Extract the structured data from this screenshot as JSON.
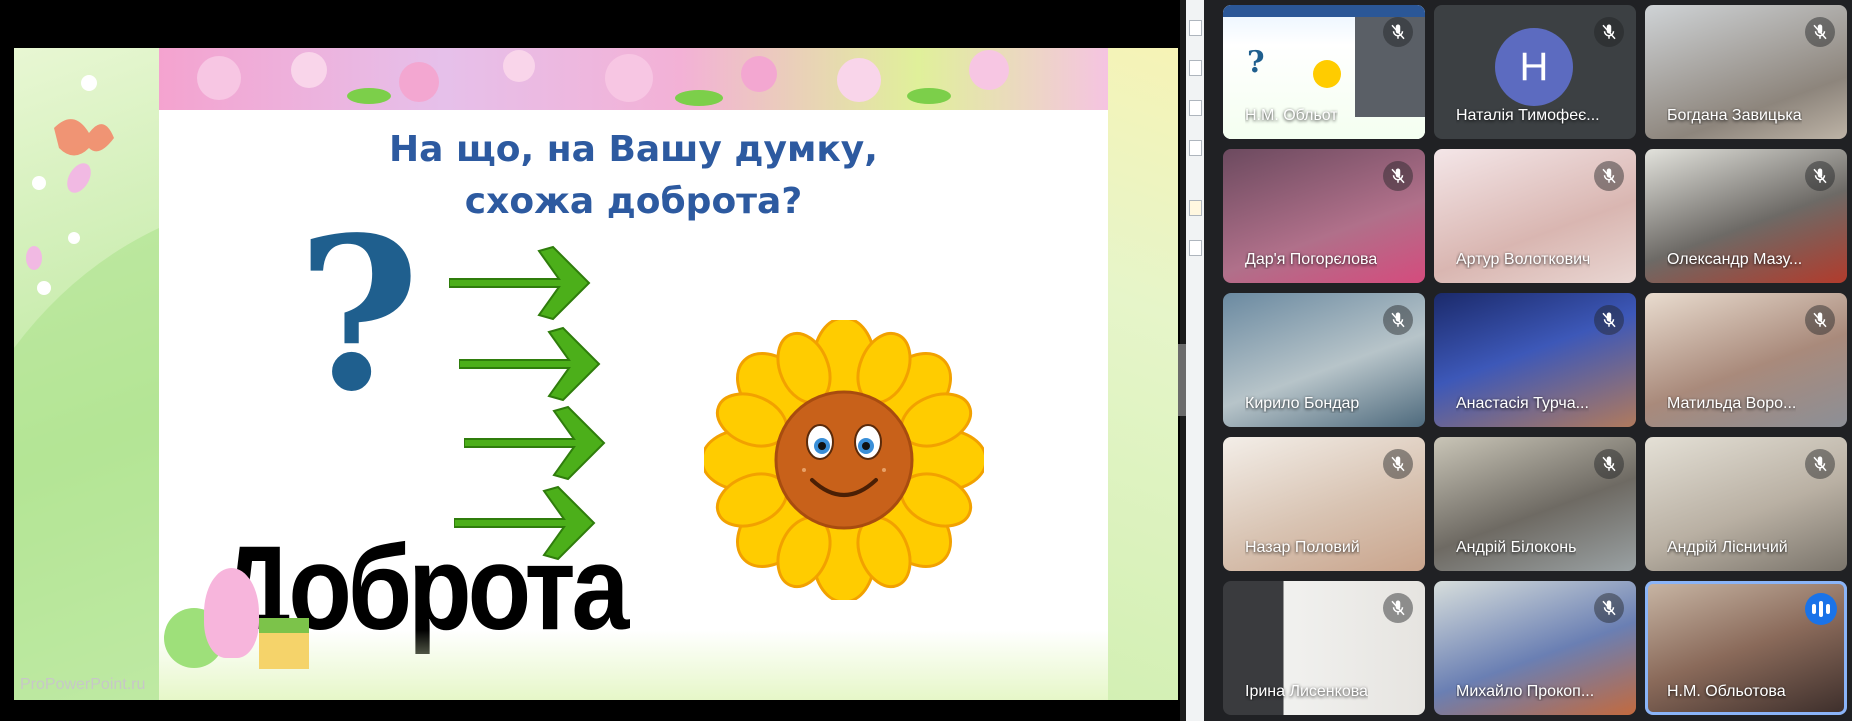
{
  "slide": {
    "title": "На що, на Вашу думку, схожа доброта?",
    "word": "Доброта",
    "question_mark": "?",
    "watermark": "ProPowerPoint.ru"
  },
  "participants": [
    {
      "name": "Н.М. Обльот",
      "mic": "muted",
      "kind": "screen-share"
    },
    {
      "name": "Наталія Тимофеє...",
      "mic": "muted",
      "kind": "avatar",
      "initial": "H",
      "avatar_color": "#5c6bc0"
    },
    {
      "name": "Богдана Завицька",
      "mic": "muted",
      "kind": "video"
    },
    {
      "name": "Дар'я Погорєлова",
      "mic": "muted",
      "kind": "video"
    },
    {
      "name": "Артур Волоткович",
      "mic": "muted",
      "kind": "video"
    },
    {
      "name": "Олександр Мазу...",
      "mic": "muted",
      "kind": "video"
    },
    {
      "name": "Кирило Бондар",
      "mic": "muted",
      "kind": "video"
    },
    {
      "name": "Анастасія Турча...",
      "mic": "muted",
      "kind": "video"
    },
    {
      "name": "Матильда Воро...",
      "mic": "muted",
      "kind": "video"
    },
    {
      "name": "Назар Половий",
      "mic": "muted",
      "kind": "video"
    },
    {
      "name": "Андрій Білоконь",
      "mic": "muted",
      "kind": "video"
    },
    {
      "name": "Андрій Лісничий",
      "mic": "muted",
      "kind": "video"
    },
    {
      "name": "Ірина Лисенкова",
      "mic": "muted",
      "kind": "video"
    },
    {
      "name": "Михайло Прокоп...",
      "mic": "muted",
      "kind": "video"
    },
    {
      "name": "Н.М. Обльотова",
      "mic": "speaking",
      "kind": "video"
    }
  ],
  "colors": {
    "grid_bg": "#202124",
    "active_border": "#8ab4f8",
    "speaking_badge": "#1a73e8",
    "title_blue": "#2d5aa0",
    "arrow_green": "#4caf1a",
    "petal_yellow": "#ffcc00"
  },
  "icons": {
    "muted": "mic-off-icon",
    "speaking": "audio-levels-icon"
  }
}
